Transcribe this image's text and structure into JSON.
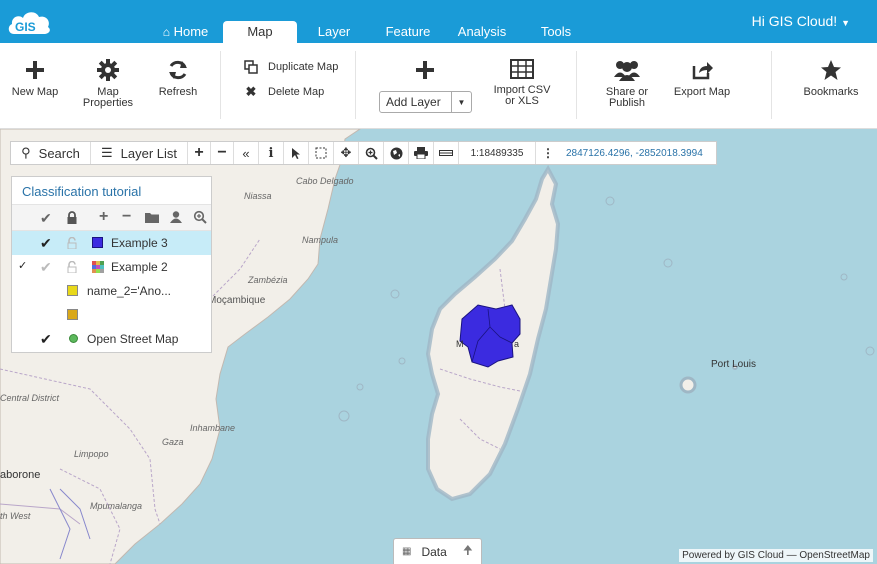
{
  "nav": {
    "tabs": [
      {
        "label": "Home"
      },
      {
        "label": "Map"
      },
      {
        "label": "Layer"
      },
      {
        "label": "Feature"
      },
      {
        "label": "Analysis"
      },
      {
        "label": "Tools"
      }
    ],
    "user_greeting": "Hi GIS Cloud!"
  },
  "logo_text": "GIS",
  "ribbon": {
    "new_map": "New Map",
    "map_properties_1": "Map",
    "map_properties_2": "Properties",
    "refresh": "Refresh",
    "duplicate_map": "Duplicate Map",
    "delete_map": "Delete Map",
    "add_layer": "Add Layer",
    "import_1": "Import CSV",
    "import_2": "or XLS",
    "share_1": "Share or",
    "share_2": "Publish",
    "export_map": "Export Map",
    "bookmarks": "Bookmarks"
  },
  "toolbar": {
    "search": "Search",
    "layer_list": "Layer List",
    "scale": "1:18489335",
    "coordinates": "2847126.4296, -2852018.3994"
  },
  "panel": {
    "title": "Classification tutorial",
    "layers": [
      {
        "name": "Example 3",
        "color": "#3b2be0"
      },
      {
        "name": "Example 2",
        "color": "multicolor"
      },
      {
        "name": "name_2='Ano...",
        "color": "#e8d81a"
      },
      {
        "name": "",
        "color": "#d9a81a"
      },
      {
        "name": "Open Street Map",
        "color": "#5cb85c"
      }
    ]
  },
  "map_labels": {
    "niassa": "Niassa",
    "cabo_delgado": "Cabo Delgado",
    "nampula": "Nampula",
    "zambezia": "Zambézia",
    "mocambique": "Moçambique",
    "central_district": "Central District",
    "inhambane": "Inhambane",
    "gaza": "Gaza",
    "limpopo": "Limpopo",
    "gaborone": "aborone",
    "mpumalanga": "Mpumalanga",
    "west": "th West",
    "port_louis": "Port Louis",
    "moroni": "Moroni",
    "madagascar_city": "M",
    "madagascar_city2": "a"
  },
  "data_tab": "Data",
  "attribution": "Powered by GIS Cloud — OpenStreetMap",
  "colors": {
    "brand": "#1a9bd7",
    "selection": "#c7ecf8",
    "polygon": "#3b2be0",
    "sea": "#aad3df",
    "land": "#f2efe9"
  }
}
